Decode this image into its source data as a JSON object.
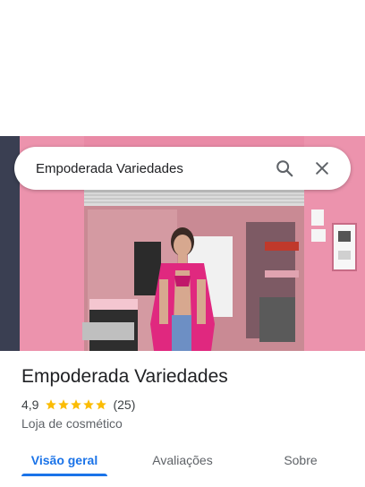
{
  "search": {
    "query": "Empoderada Variedades",
    "search_icon": "search-icon",
    "close_icon": "close-icon"
  },
  "place": {
    "name": "Empoderada Variedades",
    "rating": "4,9",
    "stars": 5,
    "review_count": "(25)",
    "category": "Loja de cosmético"
  },
  "tabs": [
    {
      "label": "Visão geral",
      "active": true
    },
    {
      "label": "Avaliações",
      "active": false
    },
    {
      "label": "Sobre",
      "active": false
    }
  ],
  "colors": {
    "accent": "#1a73e8",
    "star": "#fbbc04",
    "wall": "#e98aa6"
  }
}
